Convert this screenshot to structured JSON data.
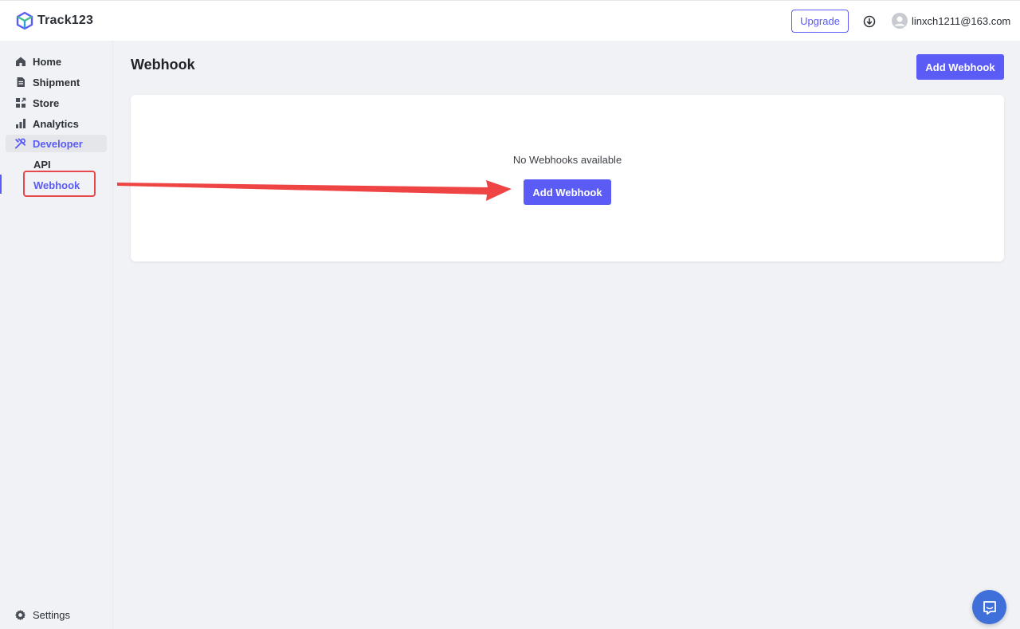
{
  "app": {
    "name": "Track123"
  },
  "header": {
    "upgrade_label": "Upgrade",
    "user_email": "linxch1211@163.com"
  },
  "sidebar": {
    "items": [
      {
        "label": "Home",
        "icon": "home-icon"
      },
      {
        "label": "Shipment",
        "icon": "document-icon"
      },
      {
        "label": "Store",
        "icon": "store-icon"
      },
      {
        "label": "Analytics",
        "icon": "bar-chart-icon"
      },
      {
        "label": "Developer",
        "icon": "tools-icon",
        "active": true
      }
    ],
    "sub_items": [
      {
        "label": "API"
      },
      {
        "label": "Webhook",
        "active": true
      }
    ],
    "settings_label": "Settings"
  },
  "main": {
    "title": "Webhook",
    "add_button_label": "Add Webhook",
    "empty_text": "No Webhooks available",
    "empty_add_button_label": "Add Webhook"
  },
  "colors": {
    "accent": "#5b5bf6",
    "annotation": "#e5484d",
    "chat": "#3f6fd8"
  }
}
